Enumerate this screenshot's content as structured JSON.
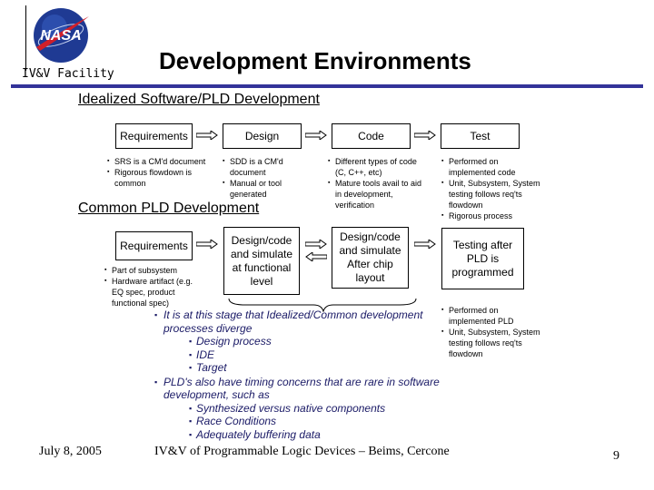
{
  "header": {
    "logo_text": "NASA",
    "facility": "IV&V Facility",
    "title": "Development Environments"
  },
  "idealized": {
    "heading": "Idealized Software/PLD Development",
    "stages": [
      {
        "label": "Requirements",
        "notes": [
          "SRS is a CM'd document",
          "Rigorous flowdown is common"
        ]
      },
      {
        "label": "Design",
        "notes": [
          "SDD is a CM'd document",
          "Manual or tool generated"
        ]
      },
      {
        "label": "Code",
        "notes": [
          "Different types of code (C, C++, etc)",
          "Mature tools avail to aid in development, verification"
        ]
      },
      {
        "label": "Test",
        "notes": [
          "Performed on implemented code",
          "Unit, Subsystem, System testing follows req'ts flowdown",
          "Rigorous process"
        ]
      }
    ]
  },
  "common": {
    "heading": "Common PLD Development",
    "stages": [
      {
        "label": "Requirements",
        "notes": [
          "Part of subsystem",
          "Hardware artifact (e.g. EQ spec, product functional spec)"
        ]
      },
      {
        "label": "Design/code and simulate at functional level",
        "notes": []
      },
      {
        "label": "Design/code and simulate After chip layout",
        "notes": []
      },
      {
        "label": "Testing after PLD is programmed",
        "notes": [
          "Performed on implemented PLD",
          "Unit, Subsystem, System testing follows req'ts flowdown"
        ]
      }
    ]
  },
  "discussion": {
    "point1": "It is at this stage that Idealized/Common development processes diverge",
    "point1_subs": [
      "Design process",
      "IDE",
      "Target"
    ],
    "point2": "PLD's also have timing concerns that are rare in software development, such as",
    "point2_subs": [
      "Synthesized versus native components",
      "Race Conditions",
      "Adequately buffering data"
    ]
  },
  "footer": {
    "date": "July 8, 2005",
    "center": "IV&V of Programmable Logic Devices – Beims, Cercone",
    "page": "9"
  },
  "colors": {
    "rule": "#333399",
    "discussion_text": "#1a1a66"
  }
}
